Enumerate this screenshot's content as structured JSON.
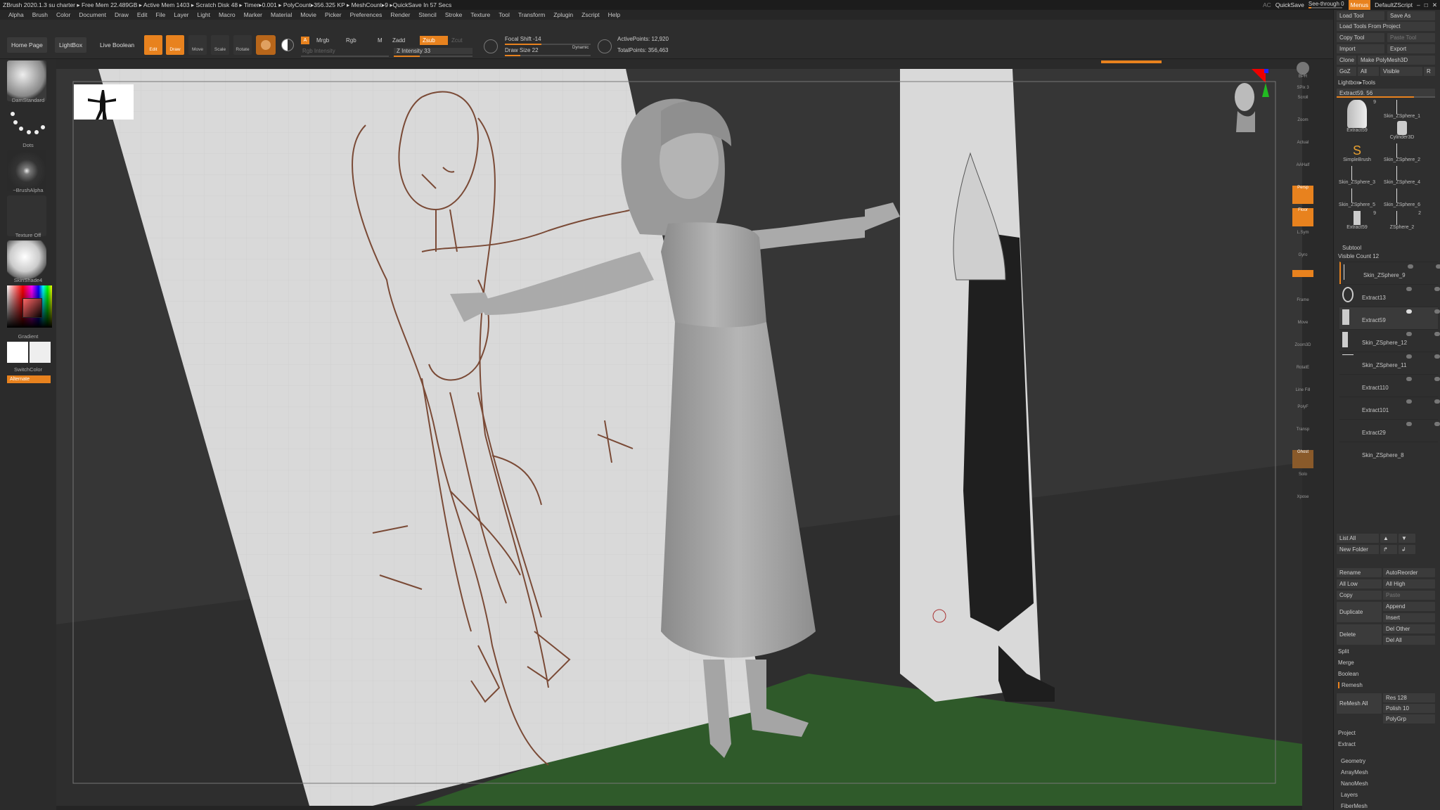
{
  "titlebar": {
    "text": "ZBrush 2020.1.3    su charter    ▸ Free Mem 22.489GB ▸ Active Mem 1403 ▸ Scratch Disk 48 ▸ Timer▸0.001 ▸ PolyCount▸356.325 KP ▸ MeshCount▸9 ▸QuickSave In 57 Secs",
    "ac": "AC",
    "quicksave": "QuickSave",
    "seethrough": "See-through  0",
    "menus": "Menus",
    "script": "DefaultZScript"
  },
  "menubar": [
    "Alpha",
    "Brush",
    "Color",
    "Document",
    "Draw",
    "Edit",
    "File",
    "Layer",
    "Light",
    "Macro",
    "Marker",
    "Material",
    "Movie",
    "Picker",
    "Preferences",
    "Render",
    "Stencil",
    "Stroke",
    "Texture",
    "Tool",
    "Transform",
    "Zplugin",
    "Zscript",
    "Help"
  ],
  "toolbar": {
    "home": "Home Page",
    "lightbox": "LightBox",
    "liveboolean": "Live Boolean",
    "edit": "Edit",
    "draw": "Draw",
    "move": "Move",
    "scale": "Scale",
    "rotate": "Rotate",
    "a": "A",
    "mrgb": "Mrgb",
    "rgb": "Rgb",
    "m": "M",
    "zadd": "Zadd",
    "zsub": "Zsub",
    "zcut": "Zcut",
    "rgb_intensity": "Rgb Intensity",
    "z_intensity": "Z Intensity 33",
    "focal_shift": "Focal Shift -14",
    "draw_size": "Draw Size 22",
    "dynamic": "Dynamic",
    "active_points": "ActivePoints: 12,920",
    "total_points": "TotalPoints: 356,463"
  },
  "leftshelf": {
    "brush": "DamStandard",
    "stroke": "Dots",
    "alpha": "~BrushAlpha",
    "texture": "Texture Off",
    "material": "SkinShade4",
    "gradient": "Gradient",
    "switch": "SwitchColor",
    "alternate": "Alternate"
  },
  "rightshelf": [
    "BPR",
    "SPix 3",
    "Scroll",
    "Zoom",
    "Actual",
    "AAHalf",
    "Persp",
    "Floor",
    "L.Sym",
    "Gyro",
    "Frame",
    "Move",
    "Zoom3D",
    "RotatE",
    "Line Fill",
    "PolyF",
    "Transp",
    "Ghost",
    "Solo",
    "Xpose"
  ],
  "rpanel": {
    "load_tool": "Load Tool",
    "save_as": "Save As",
    "load_project": "Load Tools From Project",
    "copy_tool": "Copy Tool",
    "paste_tool": "Paste Tool",
    "import": "Import",
    "export": "Export",
    "clone": "Clone",
    "make_polymesh": "Make PolyMesh3D",
    "goz": "GoZ",
    "all": "All",
    "visible": "Visible",
    "r": "R",
    "lightbox_tools": "Lightbox▸Tools",
    "extract_slider": "Extract59. 56",
    "tools": [
      {
        "name": "Extract59",
        "count": "9"
      },
      {
        "name": "Skin_ZSphere_1",
        "count": ""
      },
      {
        "name": "Cylinder3D",
        "count": ""
      },
      {
        "name": "SimpleBrush",
        "count": ""
      },
      {
        "name": "Skin_ZSphere_2",
        "count": ""
      },
      {
        "name": "Skin_ZSphere_3",
        "count": ""
      },
      {
        "name": "Skin_ZSphere_4",
        "count": ""
      },
      {
        "name": "Skin_ZSphere_5",
        "count": ""
      },
      {
        "name": "Skin_ZSphere_6",
        "count": ""
      },
      {
        "name": "Extract59",
        "count": "9"
      },
      {
        "name": "ZSphere_2",
        "count": "2"
      }
    ],
    "subtool": "Subtool",
    "visible_count": "Visible Count 12",
    "subtools": [
      "Skin_ZSphere_9",
      "Extract13",
      "Extract59",
      "Skin_ZSphere_12",
      "Skin_ZSphere_11",
      "Extract110",
      "Extract101",
      "Extract29",
      "Skin_ZSphere_8"
    ],
    "list_all": "List All",
    "new_folder": "New Folder",
    "rename": "Rename",
    "autoreorder": "AutoReorder",
    "all_low": "All Low",
    "all_high": "All High",
    "copy": "Copy",
    "paste": "Paste",
    "duplicate": "Duplicate",
    "append": "Append",
    "insert": "Insert",
    "delete": "Delete",
    "del_other": "Del Other",
    "del_all": "Del All",
    "split": "Split",
    "merge": "Merge",
    "boolean": "Boolean",
    "remesh": "Remesh",
    "remesh_all": "ReMesh All",
    "res": "Res 128",
    "polish": "Polish 10",
    "polygrp": "PolyGrp",
    "project": "Project",
    "extract": "Extract",
    "sections": [
      "Geometry",
      "ArrayMesh",
      "NanoMesh",
      "Layers",
      "FiberMesh"
    ]
  },
  "colors": {
    "accent": "#e8821e",
    "floor": "#2f5a2a",
    "paper": "#d9d9d9",
    "sketch": "#7a4a36"
  }
}
